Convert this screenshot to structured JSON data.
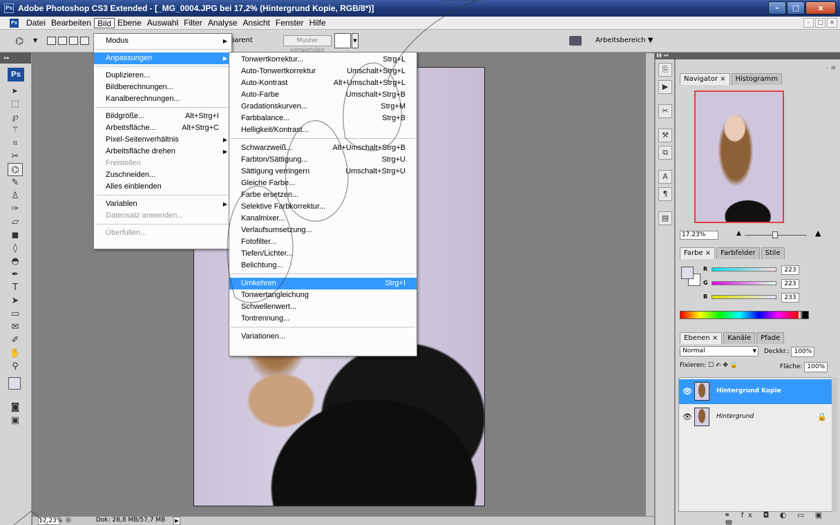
{
  "window": {
    "title": "Adobe Photoshop CS3 Extended - [_MG_0004.JPG bei 17,2% (Hintergrund Kopie, RGB/8*)]",
    "app_badge": "Ps",
    "buttons": [
      "–",
      "□",
      "x"
    ]
  },
  "menubar": {
    "badge": "Ps",
    "items": [
      "Datei",
      "Bearbeiten",
      "Bild",
      "Ebene",
      "Auswahl",
      "Filter",
      "Analyse",
      "Ansicht",
      "Fenster",
      "Hilfe"
    ],
    "active": "Bild",
    "doc_buttons": [
      "–",
      "□",
      "×"
    ]
  },
  "optionsbar": {
    "transparent_label": "parent",
    "pattern_button": "Muster verwenden",
    "workspace_label": "Arbeitsbereich ▼"
  },
  "toolbox": {
    "logo": "Ps",
    "tools": [
      {
        "name": "move-tool",
        "glyph": "▸"
      },
      {
        "name": "marquee-tool",
        "glyph": "⬚"
      },
      {
        "name": "lasso-tool",
        "glyph": "℘"
      },
      {
        "name": "magic-wand-tool",
        "glyph": "⚚"
      },
      {
        "name": "crop-tool",
        "glyph": "⌗"
      },
      {
        "name": "slice-tool",
        "glyph": "✂"
      },
      {
        "name": "patch-tool",
        "glyph": "⌬"
      },
      {
        "name": "brush-tool",
        "glyph": "✎"
      },
      {
        "name": "stamp-tool",
        "glyph": "♙"
      },
      {
        "name": "history-brush-tool",
        "glyph": "✑"
      },
      {
        "name": "eraser-tool",
        "glyph": "▱"
      },
      {
        "name": "gradient-tool",
        "glyph": "◼"
      },
      {
        "name": "blur-tool",
        "glyph": "◊"
      },
      {
        "name": "dodge-tool",
        "glyph": "◓"
      },
      {
        "name": "pen-tool",
        "glyph": "✒"
      },
      {
        "name": "type-tool",
        "glyph": "T"
      },
      {
        "name": "path-select-tool",
        "glyph": "➤"
      },
      {
        "name": "shape-tool",
        "glyph": "▭"
      },
      {
        "name": "notes-tool",
        "glyph": "✉"
      },
      {
        "name": "eyedropper-tool",
        "glyph": "✐"
      },
      {
        "name": "hand-tool",
        "glyph": "✋"
      },
      {
        "name": "zoom-tool",
        "glyph": "⚲"
      }
    ]
  },
  "bild_menu": {
    "items": [
      {
        "label": "Modus",
        "submenu": true
      },
      {
        "sep": true
      },
      {
        "label": "Anpassungen",
        "submenu": true,
        "highlight": true
      },
      {
        "sep": true
      },
      {
        "label": "Duplizieren..."
      },
      {
        "label": "Bildberechnungen..."
      },
      {
        "label": "Kanalberechnungen..."
      },
      {
        "sep": true
      },
      {
        "label": "Bildgröße...",
        "shortcut": "Alt+Strg+I"
      },
      {
        "label": "Arbeitsfläche...",
        "shortcut": "Alt+Strg+C"
      },
      {
        "label": "Pixel-Seitenverhältnis",
        "submenu": true
      },
      {
        "label": "Arbeitsfläche drehen",
        "submenu": true
      },
      {
        "label": "Freistellen",
        "disabled": true
      },
      {
        "label": "Zuschneiden..."
      },
      {
        "label": "Alles einblenden"
      },
      {
        "sep": true
      },
      {
        "label": "Variablen",
        "submenu": true
      },
      {
        "label": "Datensatz anwenden...",
        "disabled": true
      },
      {
        "sep": true
      },
      {
        "label": "Überfüllen...",
        "disabled": true
      }
    ]
  },
  "anpassungen_menu": {
    "items": [
      {
        "label": "Tonwertkorrektur...",
        "shortcut": "Strg+L"
      },
      {
        "label": "Auto-Tonwertkorrektur",
        "shortcut": "Umschalt+Strg+L"
      },
      {
        "label": "Auto-Kontrast",
        "shortcut": "Alt+Umschalt+Strg+L"
      },
      {
        "label": "Auto-Farbe",
        "shortcut": "Umschalt+Strg+B"
      },
      {
        "label": "Gradationskurven...",
        "shortcut": "Strg+M"
      },
      {
        "label": "Farbbalance...",
        "shortcut": "Strg+B"
      },
      {
        "label": "Helligkeit/Kontrast..."
      },
      {
        "sep": true
      },
      {
        "label": "Schwarzweiß...",
        "shortcut": "Alt+Umschalt+Strg+B"
      },
      {
        "label": "Farbton/Sättigung...",
        "shortcut": "Strg+U"
      },
      {
        "label": "Sättigung verringern",
        "shortcut": "Umschalt+Strg+U"
      },
      {
        "label": "Gleiche Farbe..."
      },
      {
        "label": "Farbe ersetzen..."
      },
      {
        "label": "Selektive Farbkorrektur..."
      },
      {
        "label": "Kanalmixer..."
      },
      {
        "label": "Verlaufsumsetzung..."
      },
      {
        "label": "Fotofilter..."
      },
      {
        "label": "Tiefen/Lichter..."
      },
      {
        "label": "Belichtung..."
      },
      {
        "sep": true
      },
      {
        "label": "Umkehren",
        "shortcut": "Strg+I",
        "highlight": true
      },
      {
        "label": "Tonwertangleichung"
      },
      {
        "label": "Schwellenwert..."
      },
      {
        "label": "Tontrennung..."
      },
      {
        "sep": true
      },
      {
        "label": "Variationen..."
      }
    ]
  },
  "statusbar": {
    "zoom": "17,23%",
    "doc_info": "Dok: 28,8 MB/57,7 MB"
  },
  "navigator": {
    "tabs": [
      "Navigator ×",
      "Histogramm"
    ],
    "zoom": "17.23%"
  },
  "farbe": {
    "tabs": [
      "Farbe ×",
      "Farbfelder",
      "Stile"
    ],
    "sliders": [
      {
        "label": "R",
        "value": "223",
        "gradient": "linear-gradient(90deg,#00dfe9,#ffdfe9)"
      },
      {
        "label": "G",
        "value": "223",
        "gradient": "linear-gradient(90deg,#df00e9,#dfffe9)"
      },
      {
        "label": "B",
        "value": "233",
        "gradient": "linear-gradient(90deg,#dfdf00,#dfdfff)"
      }
    ],
    "foreground": "#dfdfe9"
  },
  "ebenen": {
    "tabs": [
      "Ebenen ×",
      "Kanäle",
      "Pfade"
    ],
    "blend_mode": "Normal",
    "opacity_label": "Deckkr.:",
    "opacity_value": "100%",
    "lock_label": "Fixieren:",
    "fill_label": "Fläche:",
    "fill_value": "100%",
    "layers": [
      {
        "name": "Hintergrund Kopie",
        "selected": true
      },
      {
        "name": "Hintergrund",
        "locked": true
      }
    ],
    "footer_icons": "⚭ fx ◘ ◐ ▭ ▣ 🗑"
  }
}
